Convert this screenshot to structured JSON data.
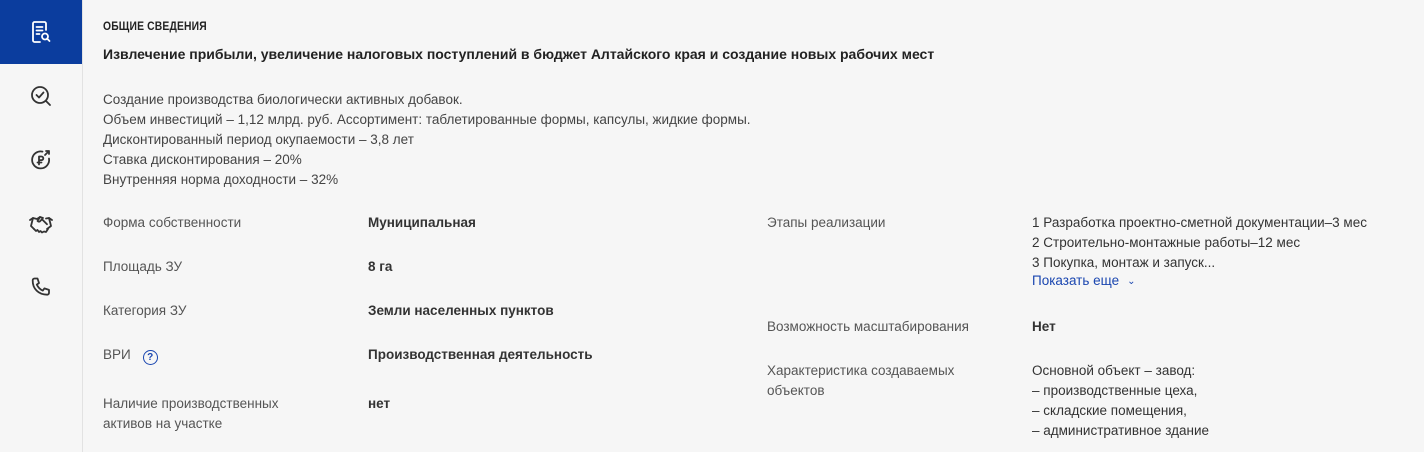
{
  "sidebar": {
    "items": [
      {
        "icon": "document-search-icon",
        "active": true
      },
      {
        "icon": "search-check-icon",
        "active": false
      },
      {
        "icon": "money-target-icon",
        "active": false
      },
      {
        "icon": "handshake-icon",
        "active": false
      },
      {
        "icon": "phone-icon",
        "active": false
      }
    ]
  },
  "section": {
    "title": "ОБЩИЕ СВЕДЕНИЯ",
    "goal": "Извлечение прибыли, увеличение налоговых поступлений в бюджет Алтайского края и создание новых рабочих мест",
    "description": [
      "Создание производства биологически активных добавок.",
      "Объем инвестиций – 1,12 млрд. руб. Ассортимент: таблетированные формы, капсулы, жидкие формы.",
      "Дисконтированный период окупаемости – 3,8 лет",
      "Ставка дисконтирования – 20%",
      "Внутренняя норма доходности – 32%"
    ]
  },
  "fields_left": [
    {
      "label": "Форма собственности",
      "value": "Муниципальная"
    },
    {
      "label": "Площадь ЗУ",
      "value": "8 га"
    },
    {
      "label": "Категория ЗУ",
      "value": "Земли населенных пунктов"
    },
    {
      "label": "ВРИ",
      "value": "Производственная деятельность",
      "help": "?"
    },
    {
      "label_lines": [
        "Наличие производственных",
        "активов на участке"
      ],
      "value": "нет"
    }
  ],
  "fields_right": {
    "stages": {
      "label": "Этапы реализации",
      "lines": [
        "1 Разработка проектно-сметной документации–3 мес",
        "2 Строительно-монтажные работы–12 мес",
        "3 Покупка, монтаж и запуск..."
      ],
      "show_more": "Показать еще"
    },
    "scaling": {
      "label": "Возможность масштабирования",
      "value": "Нет"
    },
    "objects": {
      "label_lines": [
        "Характеристика создаваемых",
        "объектов"
      ],
      "lines": [
        "Основной объект – завод:",
        "– производственные цеха,",
        "– складские помещения,",
        "– административное здание"
      ]
    }
  },
  "colors": {
    "accent": "#0b3d9e",
    "link": "#1a46b0",
    "background": "#f6f6f6"
  }
}
